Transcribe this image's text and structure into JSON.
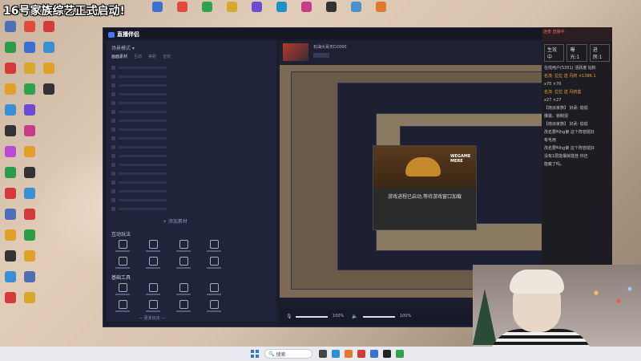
{
  "overlay": {
    "banner": "16号家族综艺正式启动!"
  },
  "app": {
    "name": "直播伴侣",
    "window_controls": [
      "—",
      "▢",
      "✕"
    ],
    "sidebar": {
      "header": "场景模式 ▾",
      "tabs": [
        "画面素材",
        "互动",
        "美颜",
        "音效"
      ],
      "add_material": "+ 添加素材",
      "section_interact": "互动玩法",
      "section_tools": "基础工具",
      "more": "— 更多玩法 —"
    },
    "room": {
      "title": "石油大哥天D2000"
    },
    "popup": {
      "brand": "WEGAME MERE",
      "message": "游戏进程已启动,等待游戏窗口加载"
    },
    "volume": {
      "mic_pct": "100%",
      "desktop_pct": "100%",
      "mic_level": 1.0,
      "desktop_level": 1.0
    }
  },
  "chat": {
    "header": "连麦 直播中",
    "tabs": [
      "生效中",
      "曝光:1",
      "进房:1"
    ],
    "lines": [
      {
        "text": "在线用户(5351) 活跃度 钻粉"
      },
      {
        "text": "名流· 拉拉 送 丹药 ×1386.1"
      },
      {
        "text": "x70  ×70"
      },
      {
        "text": "名流· 拉拉 送 丹药盒"
      },
      {
        "text": "x27  ×27"
      },
      {
        "text": "【南派家族】 好武· 偷偷"
      },
      {
        "text": "爆装。锁制混"
      },
      {
        "text": "【南派家族】 好武· 偷偷"
      },
      {
        "text": "改名要叫hg第 这个阵容挺好"
      },
      {
        "text": "有毛用"
      },
      {
        "text": "改名要叫hg第 这个阵容挺好"
      },
      {
        "text": "没有1层能摆就能挂 你还"
      },
      {
        "text": "能戴了吗。"
      }
    ]
  },
  "taskbar": {
    "search_placeholder": "搜索"
  }
}
